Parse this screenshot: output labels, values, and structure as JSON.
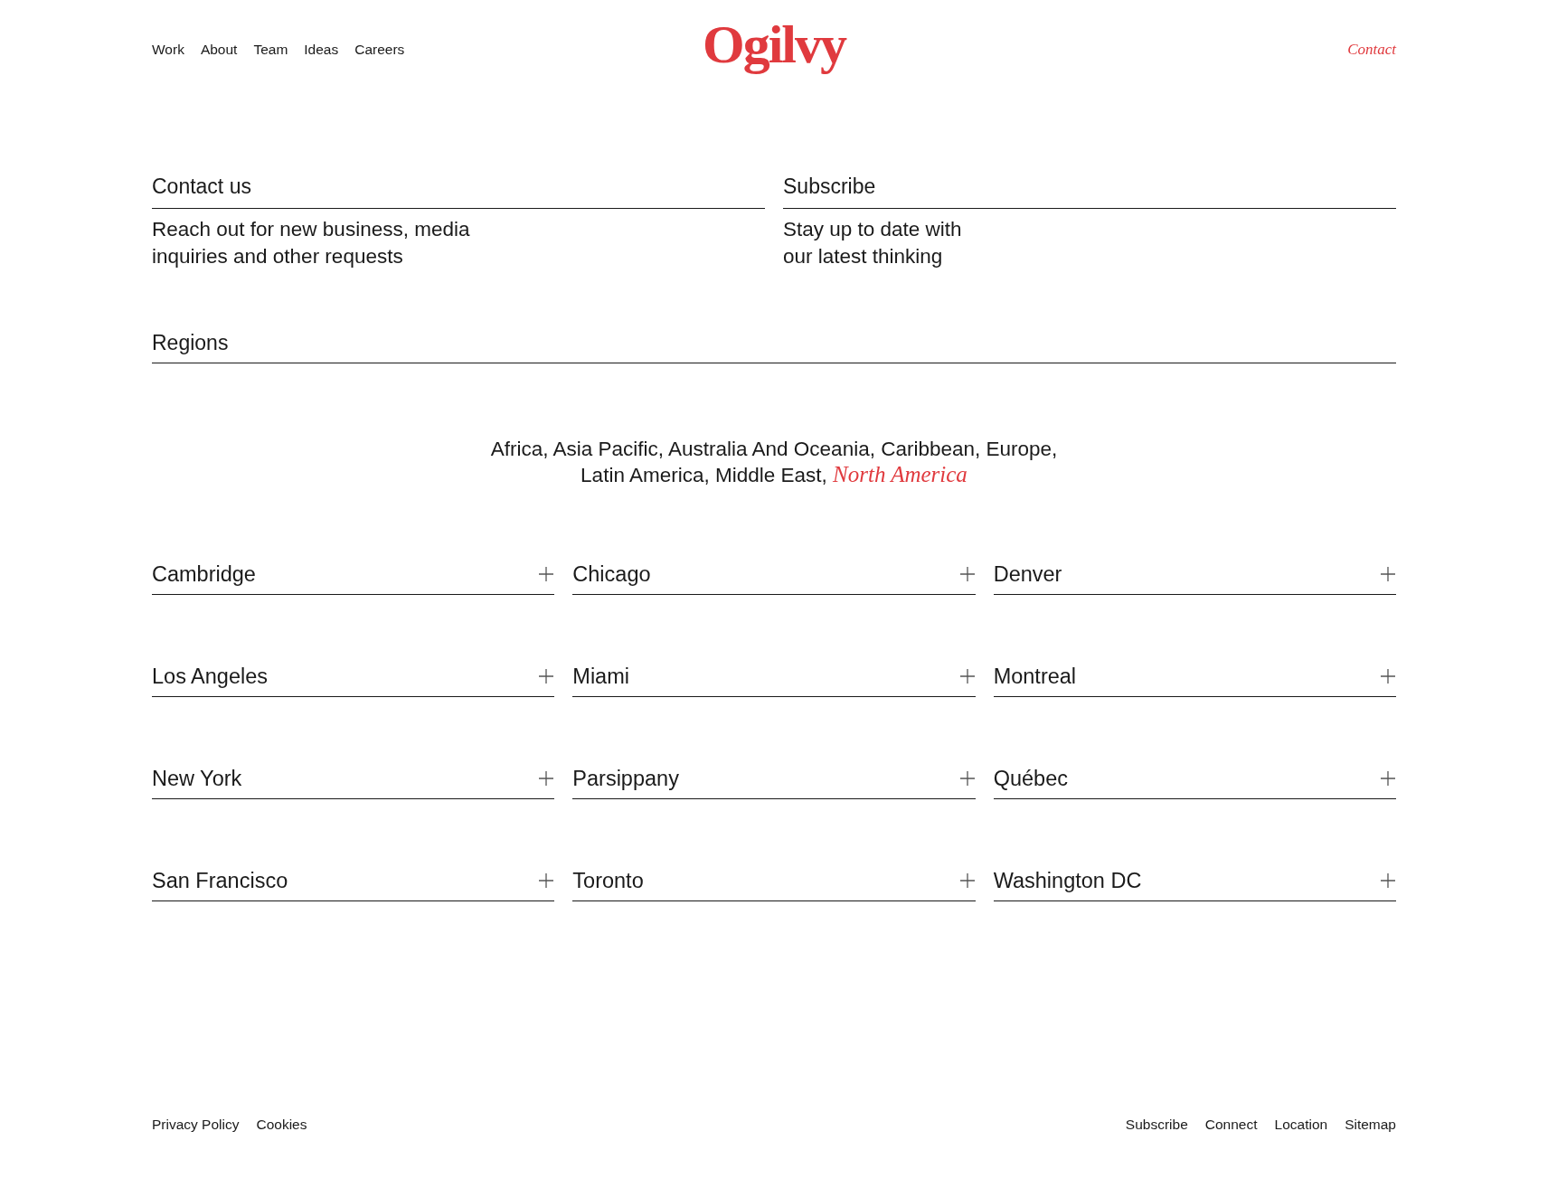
{
  "header": {
    "nav": [
      {
        "label": "Work",
        "selected": false
      },
      {
        "label": "About",
        "selected": false
      },
      {
        "label": "Team",
        "selected": false
      },
      {
        "label": "Ideas",
        "selected": false
      },
      {
        "label": "Careers",
        "selected": false
      }
    ],
    "logo": "Ogilvy",
    "contact_link": {
      "label": "Contact",
      "selected": true
    }
  },
  "panels": [
    {
      "title": "Contact us",
      "description": "Reach out for new business, media\ninquiries and other requests"
    },
    {
      "title": "Subscribe",
      "description": "Stay up to date with\nour latest thinking"
    }
  ],
  "regions": {
    "title": "Regions",
    "items": [
      {
        "label": "Africa,",
        "selected": false
      },
      {
        "label": "Asia Pacific,",
        "selected": false
      },
      {
        "label": "Australia And Oceania,",
        "selected": false
      },
      {
        "label": "Caribbean,",
        "selected": false
      },
      {
        "label": "Europe,",
        "selected": false
      },
      {
        "label": "Latin America,",
        "selected": false
      },
      {
        "label": "Middle East,",
        "selected": false
      },
      {
        "label": "North America",
        "selected": true
      }
    ]
  },
  "cities": [
    {
      "name": "Cambridge",
      "expanded": false
    },
    {
      "name": "Chicago",
      "expanded": false
    },
    {
      "name": "Denver",
      "expanded": false
    },
    {
      "name": "Los Angeles",
      "expanded": false
    },
    {
      "name": "Miami",
      "expanded": false
    },
    {
      "name": "Montreal",
      "expanded": false
    },
    {
      "name": "New York",
      "expanded": false
    },
    {
      "name": "Parsippany",
      "expanded": false
    },
    {
      "name": "Québec",
      "expanded": false
    },
    {
      "name": "San Francisco",
      "expanded": false
    },
    {
      "name": "Toronto",
      "expanded": false
    },
    {
      "name": "Washington DC",
      "expanded": false
    }
  ],
  "footer": {
    "left_links": [
      "Privacy Policy",
      "Cookies"
    ],
    "right_links": [
      "Subscribe",
      "Connect",
      "Location",
      "Sitemap"
    ]
  }
}
